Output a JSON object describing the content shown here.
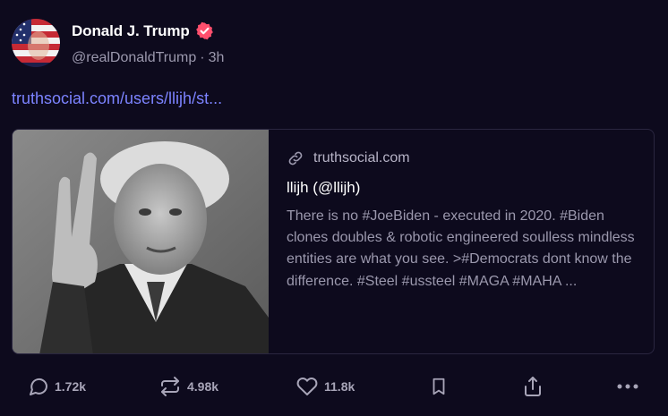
{
  "author": {
    "name": "Donald J. Trump",
    "handle": "@realDonaldTrump",
    "time": "3h",
    "separator": "·"
  },
  "post": {
    "link_text": "truthsocial.com/users/llijh/st..."
  },
  "card": {
    "domain": "truthsocial.com",
    "title": "llijh (@llijh)",
    "description": "There is no #JoeBiden - executed in 2020. #Biden clones doubles & robotic engineered soulless mindless entities are what you see. >#Democrats dont know the difference. #Steel #ussteel #MAGA #MAHA ..."
  },
  "actions": {
    "replies": "1.72k",
    "retruths": "4.98k",
    "likes": "11.8k"
  },
  "colors": {
    "background": "#0d0a1d",
    "link": "#7c83ff",
    "verified": "#ff4f6d"
  },
  "icons": [
    "chat-bubble-icon",
    "retruth-icon",
    "heart-icon",
    "bookmark-icon",
    "share-icon",
    "more-icon",
    "link-icon",
    "verified-badge-icon"
  ]
}
